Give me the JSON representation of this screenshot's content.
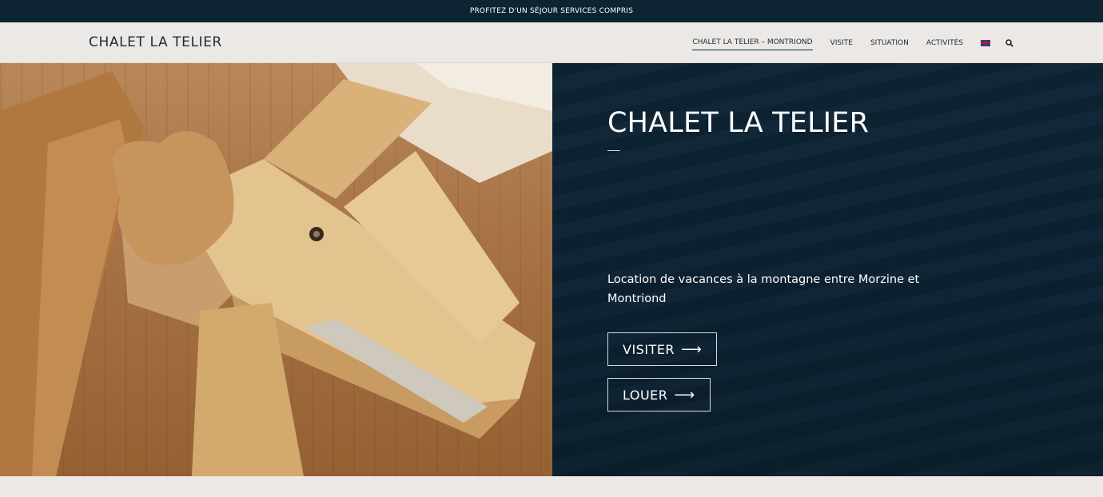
{
  "topbar": {
    "text": "PROFITEZ D'UN SÉJOUR SERVICES COMPRIS"
  },
  "header": {
    "brand": "CHALET LA TELIER",
    "nav": [
      {
        "label": "CHALET LA TELIER – MONTRIOND",
        "active": true
      },
      {
        "label": "VISITE"
      },
      {
        "label": "SITUATION"
      },
      {
        "label": "ACTIVITÉS"
      }
    ],
    "language_icon": "uk-flag-icon",
    "search_icon": "search-icon"
  },
  "hero": {
    "title": "CHALET LA TELIER",
    "subtitle": "Location de vacances à la montagne entre Morzine et Montriond",
    "buttons": [
      {
        "label": "VISITER",
        "arrow": "⟶"
      },
      {
        "label": "LOUER",
        "arrow": "⟶"
      }
    ]
  },
  "colors": {
    "dark_navy": "#0d2433",
    "light_bg": "#ebe8e5",
    "wood": "#a87447"
  }
}
